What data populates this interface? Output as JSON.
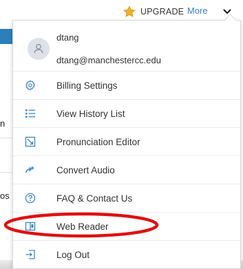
{
  "header": {
    "upgrade_label": "UPGRADE",
    "more_label": "More"
  },
  "background": {
    "frag1": "n",
    "frag2": "os"
  },
  "user": {
    "name": "dtang",
    "email": "dtang@manchestercc.edu"
  },
  "menu": {
    "items": [
      {
        "label": "Billing Settings",
        "icon": "gear-icon"
      },
      {
        "label": "View History List",
        "icon": "list-icon"
      },
      {
        "label": "Pronunciation Editor",
        "icon": "pronunciation-editor-icon"
      },
      {
        "label": "Convert Audio",
        "icon": "convert-audio-icon"
      },
      {
        "label": "FAQ & Contact Us",
        "icon": "help-icon"
      },
      {
        "label": "Web Reader",
        "icon": "web-reader-icon"
      },
      {
        "label": "Log Out",
        "icon": "logout-icon"
      }
    ]
  },
  "colors": {
    "accent": "#3a7fc6",
    "icon": "#3a86c8",
    "star": "#f2b01e",
    "annotation": "#e01010"
  }
}
